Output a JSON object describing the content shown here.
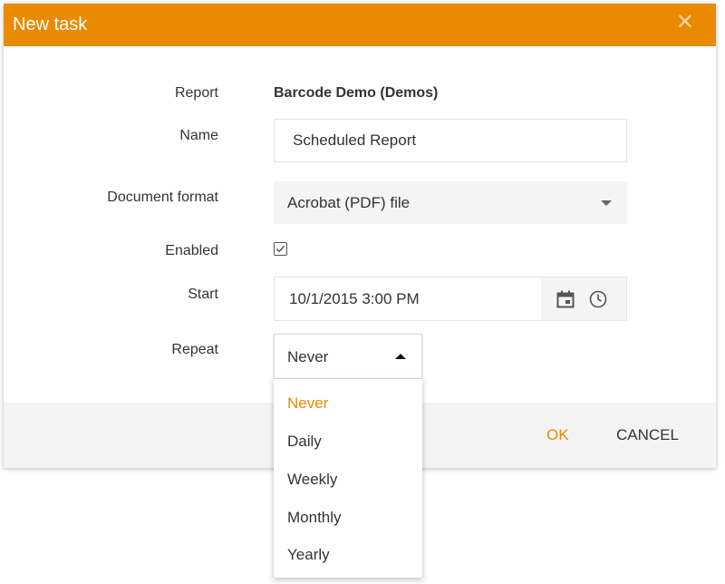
{
  "dialog": {
    "title": "New task",
    "close_icon": "close-icon",
    "close_glyph": "✕"
  },
  "form": {
    "report_label": "Report",
    "report_value": "Barcode Demo (Demos)",
    "name_label": "Name",
    "name_value": "Scheduled Report",
    "format_label": "Document format",
    "format_value": "Acrobat (PDF) file",
    "enabled_label": "Enabled",
    "enabled_checked": true,
    "start_label": "Start",
    "start_value": "10/1/2015 3:00 PM",
    "start_icons": [
      "calendar-icon",
      "clock-icon"
    ],
    "repeat_label": "Repeat",
    "repeat_value": "Never"
  },
  "repeat_options": [
    "Never",
    "Daily",
    "Weekly",
    "Monthly",
    "Yearly"
  ],
  "buttons": {
    "ok": "OK",
    "cancel": "CANCEL"
  },
  "colors": {
    "accent": "#ea8a00",
    "text": "#333333",
    "field_bg": "#f5f5f5"
  }
}
